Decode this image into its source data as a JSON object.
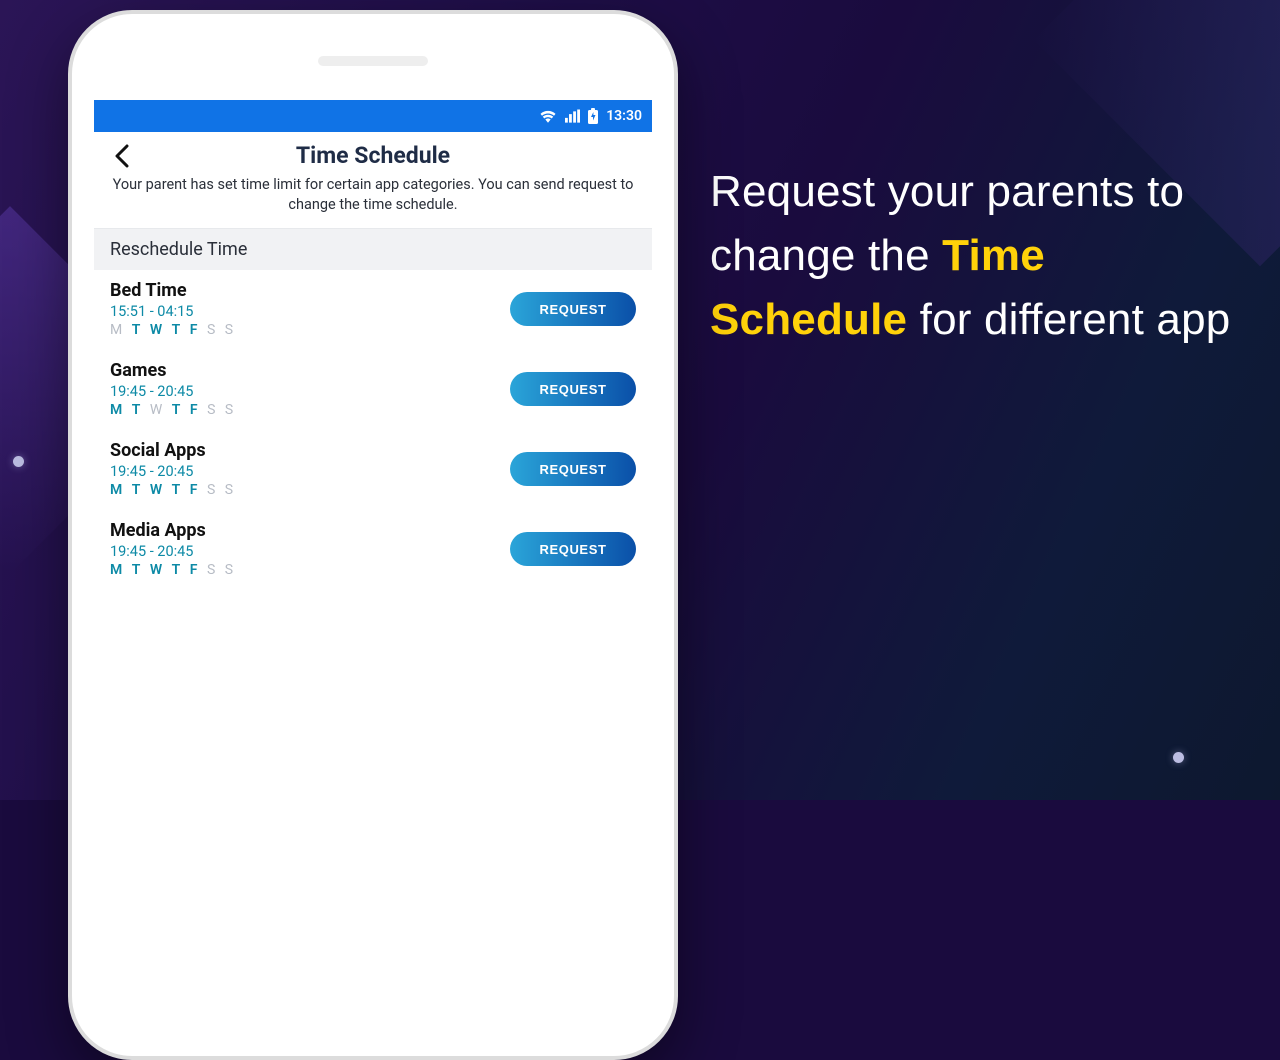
{
  "statusbar": {
    "time": "13:30"
  },
  "header": {
    "title": "Time Schedule",
    "description": "Your parent has set time limit for certain app categories. You can send request to change the time schedule."
  },
  "section": {
    "title": "Reschedule Time"
  },
  "day_labels": [
    "M",
    "T",
    "W",
    "T",
    "F",
    "S",
    "S"
  ],
  "button_label": "REQUEST",
  "schedules": [
    {
      "name": "Bed Time",
      "time": "15:51 - 04:15",
      "days_active": [
        false,
        true,
        true,
        true,
        true,
        false,
        false
      ]
    },
    {
      "name": "Games",
      "time": "19:45 - 20:45",
      "days_active": [
        true,
        true,
        false,
        true,
        true,
        false,
        false
      ]
    },
    {
      "name": "Social Apps",
      "time": "19:45 - 20:45",
      "days_active": [
        true,
        true,
        true,
        true,
        true,
        false,
        false
      ]
    },
    {
      "name": "Media Apps",
      "time": "19:45 - 20:45",
      "days_active": [
        true,
        true,
        true,
        true,
        true,
        false,
        false
      ]
    }
  ],
  "caption": {
    "pre": "Request your parents to change the ",
    "highlight": "Time Schedule",
    "post": " for different app"
  }
}
